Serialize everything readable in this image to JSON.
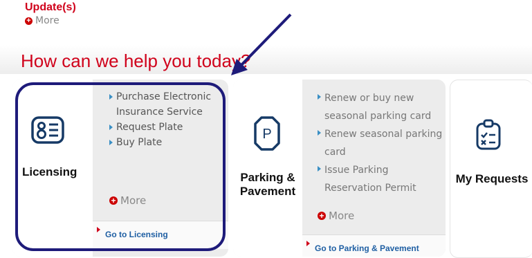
{
  "updates": {
    "title": "Update(s)",
    "more": "More"
  },
  "help": {
    "title": "How can we help you today?"
  },
  "cards": {
    "licensing": {
      "label": "Licensing",
      "icon": "id-card-icon",
      "links": [
        "Purchase Electronic Insurance Service",
        "Request Plate",
        "Buy Plate"
      ],
      "more": "More",
      "go": "Go to Licensing"
    },
    "parking": {
      "label": "Parking & Pavement",
      "icon": "parking-sign-icon",
      "links": [
        "Renew or buy new seasonal parking card",
        "Renew seasonal parking card",
        "Issue Parking Reservation Permit"
      ],
      "more": "More",
      "go": "Go to Parking & Pavement"
    },
    "requests": {
      "label": "My Requests",
      "icon": "clipboard-checklist-icon"
    }
  },
  "colors": {
    "accent_red": "#d0021b",
    "highlight": "#1e1b7a",
    "link_blue": "#1f5fa3",
    "bullet_blue": "#3a8fc4"
  }
}
